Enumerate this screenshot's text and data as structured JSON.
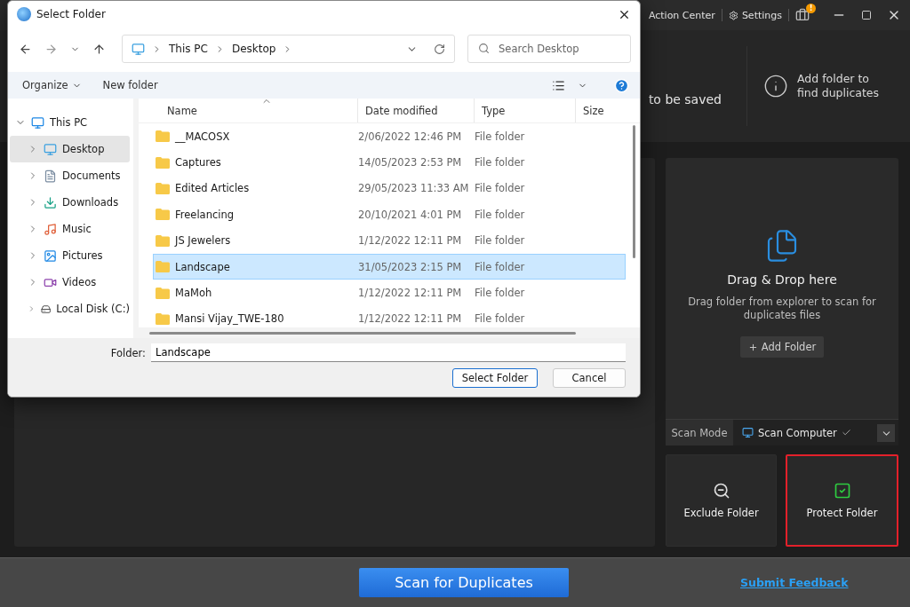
{
  "title_bar": {
    "items": [
      {
        "label": "Action Center",
        "kind": "grid"
      },
      {
        "label": "Settings",
        "kind": "gear"
      }
    ],
    "badge": "!"
  },
  "summary": {
    "saved_label": "to be saved",
    "hint": "Add folder to find duplicates"
  },
  "drop_zone": {
    "title": "Drag & Drop here",
    "text": "Drag folder from explorer to scan for duplicates files",
    "add_button": "Add Folder"
  },
  "scan_mode": {
    "label": "Scan Mode",
    "value": "Scan Computer"
  },
  "actions": [
    {
      "label": "Exclude Folder",
      "kind": "exclude",
      "highlighted": false
    },
    {
      "label": "Protect Folder",
      "kind": "protect",
      "highlighted": true
    }
  ],
  "footer": {
    "scan_button": "Scan for Duplicates",
    "feedback_link": "Submit Feedback"
  },
  "dialog": {
    "title": "Select Folder",
    "breadcrumb": [
      "This PC",
      "Desktop"
    ],
    "search_placeholder": "Search Desktop",
    "toolbar": {
      "organize": "Organize",
      "new_folder": "New folder"
    },
    "nav": [
      {
        "label": "This PC",
        "kind": "pc",
        "expanded": true,
        "selected": false,
        "children": [
          {
            "label": "Desktop",
            "kind": "desktop",
            "expanded": false,
            "selected": true
          },
          {
            "label": "Documents",
            "kind": "documents",
            "expanded": false,
            "selected": false
          },
          {
            "label": "Downloads",
            "kind": "downloads",
            "expanded": false,
            "selected": false
          },
          {
            "label": "Music",
            "kind": "music",
            "expanded": false,
            "selected": false
          },
          {
            "label": "Pictures",
            "kind": "pictures",
            "expanded": false,
            "selected": false
          },
          {
            "label": "Videos",
            "kind": "videos",
            "expanded": false,
            "selected": false
          },
          {
            "label": "Local Disk (C:)",
            "kind": "disk",
            "expanded": false,
            "selected": false
          }
        ]
      }
    ],
    "columns": [
      "Name",
      "Date modified",
      "Type",
      "Size"
    ],
    "rows": [
      {
        "name": "__MACOSX",
        "date": "2/06/2022 12:46 PM",
        "type": "File folder",
        "selected": false
      },
      {
        "name": "Captures",
        "date": "14/05/2023 2:53 PM",
        "type": "File folder",
        "selected": false
      },
      {
        "name": "Edited Articles",
        "date": "29/05/2023 11:33 AM",
        "type": "File folder",
        "selected": false
      },
      {
        "name": "Freelancing",
        "date": "20/10/2021 4:01 PM",
        "type": "File folder",
        "selected": false
      },
      {
        "name": "JS Jewelers",
        "date": "1/12/2022 12:11 PM",
        "type": "File folder",
        "selected": false
      },
      {
        "name": "Landscape",
        "date": "31/05/2023 2:15 PM",
        "type": "File folder",
        "selected": true
      },
      {
        "name": "MaMoh",
        "date": "1/12/2022 12:11 PM",
        "type": "File folder",
        "selected": false
      },
      {
        "name": "Mansi Vijay_TWE-180",
        "date": "1/12/2022 12:11 PM",
        "type": "File folder",
        "selected": false
      }
    ],
    "folder_label": "Folder:",
    "folder_value": "Landscape",
    "buttons": [
      {
        "label": "Select Folder",
        "primary": true
      },
      {
        "label": "Cancel",
        "primary": false
      }
    ]
  }
}
